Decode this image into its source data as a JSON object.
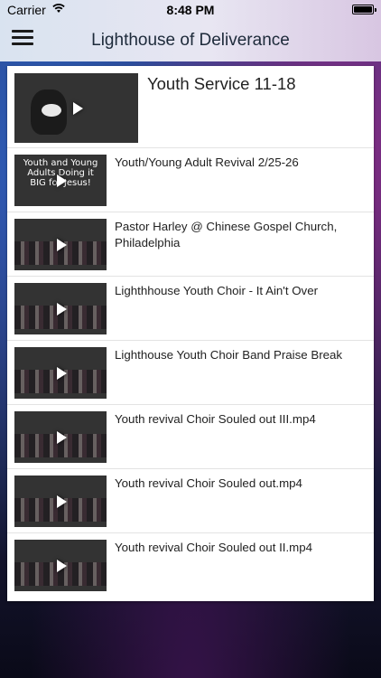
{
  "status_bar": {
    "carrier": "Carrier",
    "time": "8:48 PM"
  },
  "header": {
    "title": "Lighthouse of Deliverance",
    "menu_icon": "hamburger-menu-icon"
  },
  "videos": [
    {
      "title": "Youth Service 11-18",
      "thumbnail_caption": "",
      "icon": "play-icon"
    },
    {
      "title": "Youth/Young Adult Revival 2/25-26",
      "thumbnail_caption": "Youth and Young Adults Doing it BIG for Jesus!",
      "icon": "play-icon"
    },
    {
      "title": "Pastor Harley @ Chinese Gospel Church, Philadelphia",
      "thumbnail_caption": "",
      "icon": "play-icon"
    },
    {
      "title": "Lighthhouse Youth Choir - It Ain't Over",
      "thumbnail_caption": "",
      "icon": "play-icon"
    },
    {
      "title": "Lighthouse Youth Choir Band Praise Break",
      "thumbnail_caption": "",
      "icon": "play-icon"
    },
    {
      "title": "Youth revival Choir Souled out III.mp4",
      "thumbnail_caption": "",
      "icon": "play-icon"
    },
    {
      "title": "Youth revival Choir Souled out.mp4",
      "thumbnail_caption": "",
      "icon": "play-icon"
    },
    {
      "title": "Youth revival Choir Souled out II.mp4",
      "thumbnail_caption": "",
      "icon": "play-icon"
    }
  ]
}
